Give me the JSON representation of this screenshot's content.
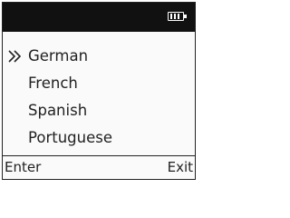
{
  "status_bar": {
    "battery_icon": "battery-full-icon",
    "battery_level": 1.0
  },
  "menu": {
    "selector_icon": "double-chevron-right-icon",
    "selected_index": 0,
    "items": [
      {
        "label": "German"
      },
      {
        "label": "French"
      },
      {
        "label": "Spanish"
      },
      {
        "label": "Portuguese"
      }
    ]
  },
  "softkeys": {
    "left_label": "Enter",
    "right_label": "Exit"
  },
  "colors": {
    "status_bar": "#111111",
    "screen": "#fafafa",
    "text": "#222222"
  }
}
